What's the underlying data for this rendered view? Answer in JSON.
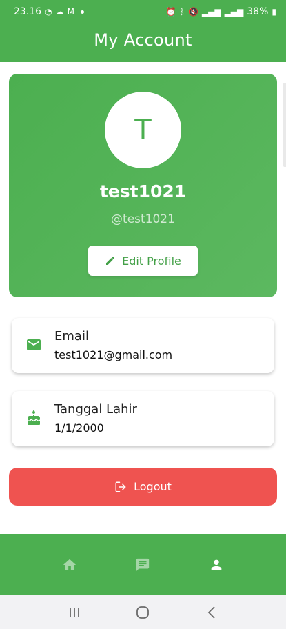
{
  "status_bar": {
    "time": "23.16",
    "battery": "38%"
  },
  "app_bar": {
    "title": "My Account"
  },
  "profile": {
    "avatar_initial": "T",
    "username": "test1021",
    "handle": "@test1021",
    "edit_label": "Edit Profile"
  },
  "info": {
    "email_label": "Email",
    "email_value": "test1021@gmail.com",
    "birth_label": "Tanggal Lahir",
    "birth_value": "1/1/2000"
  },
  "logout_label": "Logout",
  "bottom_nav": {
    "items": [
      "home-icon",
      "chat-icon",
      "person-icon"
    ],
    "active": "person-icon"
  },
  "colors": {
    "primary": "#4caf50",
    "logout": "#ef5350"
  }
}
